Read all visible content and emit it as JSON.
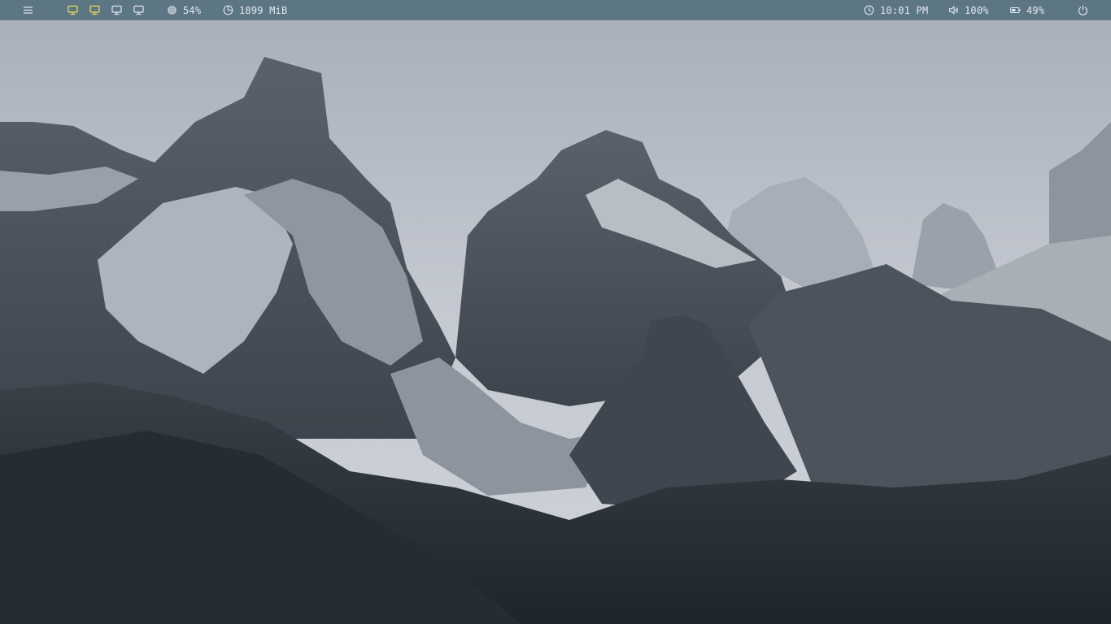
{
  "colors": {
    "bar_background": "#5d7684",
    "bar_text": "#e3e8ec",
    "workspace_active": "#e8e05a",
    "workspace_inactive": "#e3e8ec"
  },
  "statusbar": {
    "menu_icon": "menu-icon",
    "workspaces": [
      {
        "icon": "monitor-icon",
        "state": "active"
      },
      {
        "icon": "monitor-icon",
        "state": "occupied"
      },
      {
        "icon": "monitor-icon",
        "state": "empty"
      },
      {
        "icon": "monitor-icon",
        "state": "empty"
      }
    ],
    "cpu": {
      "icon": "cpu-icon",
      "value": "54%"
    },
    "memory": {
      "icon": "memory-icon",
      "value": "1899 MiB"
    },
    "clock": {
      "icon": "clock-icon",
      "value": "10:01 PM"
    },
    "volume": {
      "icon": "volume-icon",
      "value": "100%"
    },
    "battery": {
      "icon": "battery-icon",
      "value": "49%"
    },
    "power_icon": "power-icon"
  },
  "desktop": {
    "wallpaper": "grayscale mountain landscape"
  }
}
